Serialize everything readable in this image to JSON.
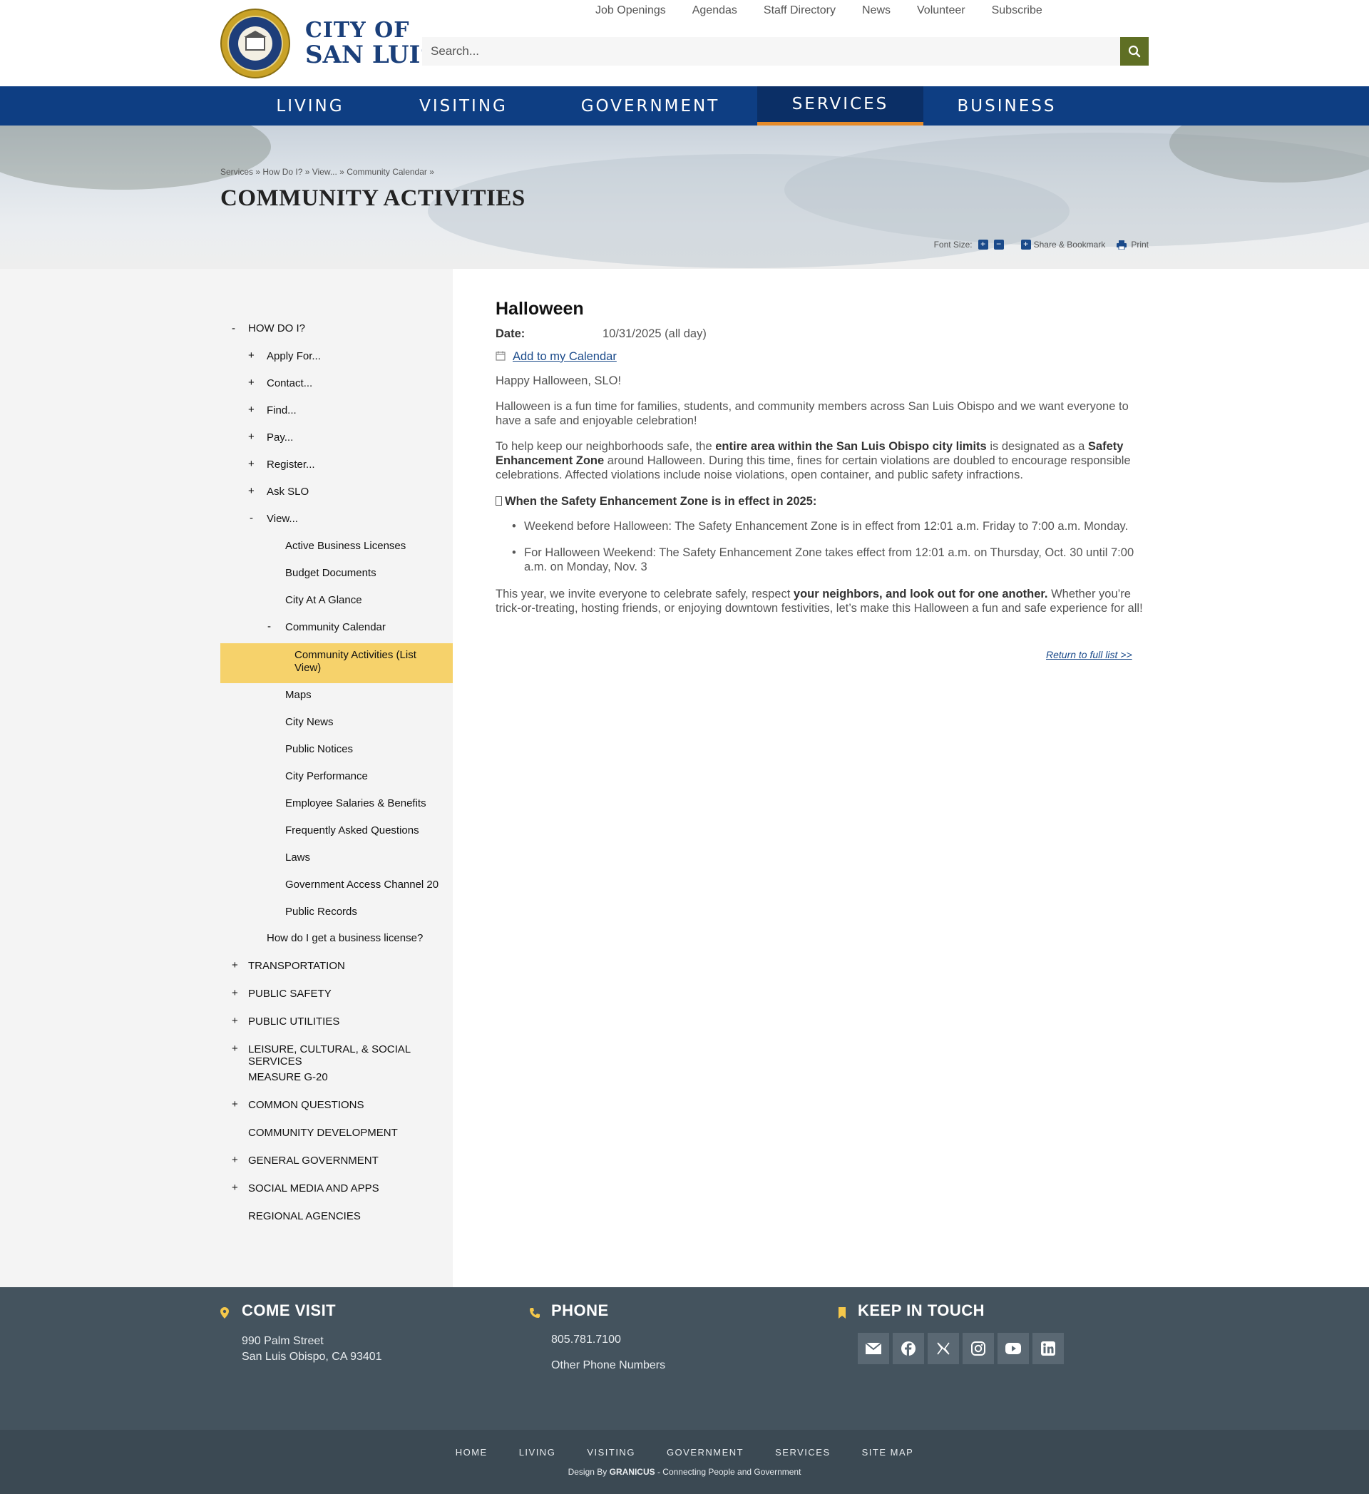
{
  "colors": {
    "nav_bg": "#0e3e83",
    "nav_active_underline": "#e58b2a",
    "search_button": "#5f6f24",
    "sidebar_active": "#f6d26b",
    "footer_bg": "#44535e",
    "link": "#1a4a8a"
  },
  "logo": {
    "line1": "CITY OF",
    "line2": "SAN LUIS",
    "seal_text": "SAN LUIS OBISPO",
    "icon": "city-seal"
  },
  "utility_nav": [
    "Job Openings",
    "Agendas",
    "Staff Directory",
    "News",
    "Volunteer",
    "Subscribe"
  ],
  "search": {
    "placeholder": "Search...",
    "icon": "search-icon"
  },
  "main_nav": [
    {
      "label": "LIVING",
      "active": false
    },
    {
      "label": "VISITING",
      "active": false
    },
    {
      "label": "GOVERNMENT",
      "active": false
    },
    {
      "label": "SERVICES",
      "active": true
    },
    {
      "label": "BUSINESS",
      "active": false
    }
  ],
  "breadcrumb": "Services » How Do I? » View... » Community Calendar »",
  "page_title": "COMMUNITY ACTIVITIES",
  "tools": {
    "font_size_label": "Font Size:",
    "increase": "+",
    "decrease": "−",
    "share_label": "Share & Bookmark",
    "print_label": "Print"
  },
  "sidebar": {
    "how_do_i": {
      "toggle": "-",
      "label": "HOW DO I?"
    },
    "level2": [
      {
        "toggle": "+",
        "label": "Apply For..."
      },
      {
        "toggle": "+",
        "label": "Contact..."
      },
      {
        "toggle": "+",
        "label": "Find..."
      },
      {
        "toggle": "+",
        "label": "Pay..."
      },
      {
        "toggle": "+",
        "label": "Register..."
      },
      {
        "toggle": "+",
        "label": "Ask SLO"
      },
      {
        "toggle": "-",
        "label": "View..."
      }
    ],
    "view_items_before": [
      "Active Business Licenses",
      "Budget Documents",
      "City At A Glance"
    ],
    "community_calendar": {
      "toggle": "-",
      "label": "Community Calendar"
    },
    "active_item": "Community Activities (List View)",
    "view_items_after": [
      "Maps",
      "City News",
      "Public Notices",
      "City Performance",
      "Employee Salaries & Benefits",
      "Frequently Asked Questions",
      "Laws",
      "Government Access Channel 20",
      "Public Records"
    ],
    "business_license": "How do I get a business license?",
    "top_level": [
      {
        "toggle": "+",
        "label": "TRANSPORTATION"
      },
      {
        "toggle": "+",
        "label": "PUBLIC SAFETY"
      },
      {
        "toggle": "+",
        "label": "PUBLIC UTILITIES"
      },
      {
        "toggle": "+",
        "label": "LEISURE, CULTURAL, & SOCIAL SERVICES"
      },
      {
        "toggle": "",
        "label": "MEASURE G-20"
      },
      {
        "toggle": "+",
        "label": "COMMON QUESTIONS"
      },
      {
        "toggle": "",
        "label": "COMMUNITY DEVELOPMENT"
      },
      {
        "toggle": "+",
        "label": "GENERAL GOVERNMENT"
      },
      {
        "toggle": "+",
        "label": "SOCIAL MEDIA AND APPS"
      },
      {
        "toggle": "",
        "label": "REGIONAL AGENCIES"
      }
    ]
  },
  "event": {
    "title": "Halloween",
    "date_label": "Date:",
    "date_value": "10/31/2025 (all day)",
    "calendar_link": "Add to my Calendar",
    "greeting": "Happy Halloween, SLO!",
    "intro": "Halloween is a fun time for families, students, and community members across San Luis Obispo and we want everyone to have a safe and enjoyable celebration!",
    "p2_a": "To help keep our neighborhoods safe, the ",
    "p2_b": "entire area within the San Luis Obispo city limits",
    "p2_c": " is designated as a ",
    "p2_d": "Safety Enhancement Zone",
    "p2_e": " around Halloween. During this time, fines for certain violations are doubled to encourage responsible celebrations. Affected violations include noise violations, open container, and public safety infractions.",
    "zone_heading": "When the Safety Enhancement Zone is in effect in 2025:",
    "bullets": [
      "Weekend before Halloween: The Safety Enhancement Zone is in effect from 12:01 a.m. Friday to 7:00 a.m. Monday.",
      "For Halloween Weekend: The Safety Enhancement Zone takes effect from 12:01 a.m. on Thursday, Oct. 30 until 7:00 a.m. on Monday, Nov. 3"
    ],
    "p3_a": "This year, we invite everyone to celebrate safely, respect ",
    "p3_b": "your neighbors, and look out for one another.",
    "p3_c": " Whether you’re trick-or-treating, hosting friends, or enjoying downtown festivities, let’s make this Halloween a fun and safe experience for all!",
    "return_link": "Return to full list >>"
  },
  "footer": {
    "visit": {
      "heading": "COME VISIT",
      "line1": "990 Palm Street",
      "line2": "San Luis Obispo, CA 93401",
      "icon": "map-pin-icon"
    },
    "phone": {
      "heading": "PHONE",
      "number": "805.781.7100",
      "other": "Other Phone Numbers",
      "icon": "phone-icon"
    },
    "touch": {
      "heading": "KEEP IN TOUCH",
      "icon": "bookmark-icon",
      "social": [
        "email-icon",
        "facebook-icon",
        "x-icon",
        "instagram-icon",
        "youtube-icon",
        "linkedin-icon"
      ]
    },
    "bottom_links": [
      "HOME",
      "LIVING",
      "VISITING",
      "GOVERNMENT",
      "SERVICES",
      "SITE MAP"
    ],
    "credit_prefix": "Design By ",
    "credit_brand": "GRANICUS",
    "credit_suffix": " - Connecting People and Government"
  }
}
